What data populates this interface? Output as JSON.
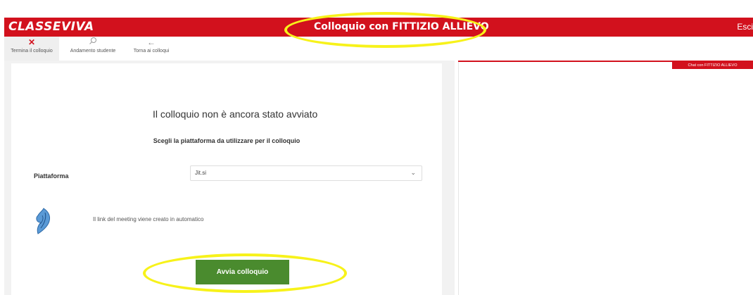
{
  "app": {
    "logo": "CLASSEVIVA",
    "title": "Colloquio con FITTIZIO ALLIEVO",
    "logout_label": "Esci"
  },
  "toolbar": {
    "items": [
      {
        "label": "Termina il colloquio",
        "icon": "close-icon"
      },
      {
        "label": "Andamento studente",
        "icon": "search-icon"
      },
      {
        "label": "Torna ai colloqui",
        "icon": "back-arrow-icon"
      }
    ]
  },
  "main": {
    "status_title": "Il colloquio non è ancora stato avviato",
    "instruction": "Scegli la piattaforma da utilizzare per il colloquio",
    "platform_label": "Piattaforma",
    "platform_value": "Jit.si",
    "auto_link_text": "Il link del meeting viene creato in automatico",
    "start_button": "Avvia colloquio"
  },
  "chat": {
    "tab_label": "Chat con FITTIZIO ALLIEVO"
  },
  "colors": {
    "brand_red": "#d2111d",
    "button_green": "#4a8b2e",
    "highlight_yellow": "#f7f21a"
  }
}
